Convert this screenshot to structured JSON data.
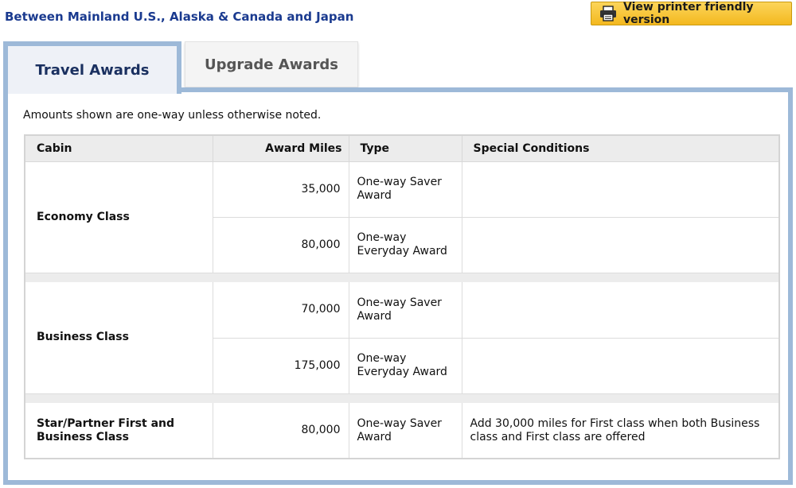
{
  "route_title": "Between Mainland U.S., Alaska & Canada and Japan",
  "print_button": {
    "label": "View printer friendly version",
    "icon": "printer-icon"
  },
  "tabs": [
    {
      "label": "Travel Awards",
      "active": true
    },
    {
      "label": "Upgrade Awards",
      "active": false
    }
  ],
  "note": "Amounts shown are one-way unless otherwise noted.",
  "table": {
    "headers": {
      "cabin": "Cabin",
      "miles": "Award Miles",
      "type": "Type",
      "conditions": "Special Conditions"
    },
    "groups": [
      {
        "cabin": "Economy Class",
        "rows": [
          {
            "miles": "35,000",
            "type": "One-way Saver Award",
            "conditions": ""
          },
          {
            "miles": "80,000",
            "type": "One-way Everyday Award",
            "conditions": ""
          }
        ]
      },
      {
        "cabin": "Business Class",
        "rows": [
          {
            "miles": "70,000",
            "type": "One-way Saver Award",
            "conditions": ""
          },
          {
            "miles": "175,000",
            "type": "One-way Everyday Award",
            "conditions": ""
          }
        ]
      },
      {
        "cabin": "Star/Partner First and Business Class",
        "rows": [
          {
            "miles": "80,000",
            "type": "One-way Saver Award",
            "conditions": "Add 30,000 miles for First class when both Business class and First class are offered"
          }
        ]
      }
    ]
  },
  "colors": {
    "title": "#1a3a8f",
    "tab_border": "#9db9d8",
    "button": "#f3b81f"
  }
}
